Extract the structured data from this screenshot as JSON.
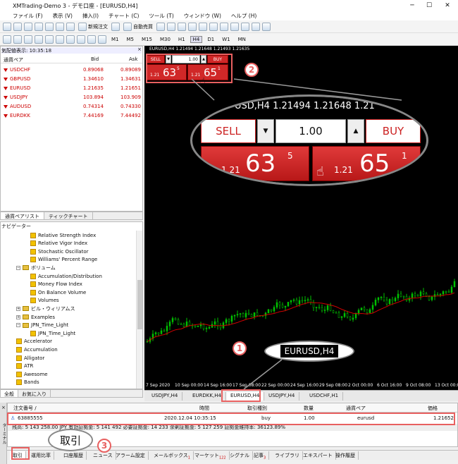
{
  "window": {
    "title": "XMTrading-Demo 3 - デモ口座 - [EURUSD,H4]",
    "minimize": "─",
    "maximize": "☐",
    "close": "✕"
  },
  "menu": [
    "ファイル (F)",
    "表示 (V)",
    "挿入(I)",
    "チャート (C)",
    "ツール (T)",
    "ウィンドウ (W)",
    "ヘルプ (H)"
  ],
  "toolbar": {
    "new_order": "新規注文",
    "auto_trading": "自動売買",
    "timeframes": [
      "M1",
      "M5",
      "M15",
      "M30",
      "H1",
      "H4",
      "D1",
      "W1",
      "MN"
    ],
    "selected_timeframe": "H4"
  },
  "market_watch": {
    "title": "気配値表示: 10:35:18",
    "close": "×",
    "col_symbol": "通貨ペア",
    "col_bid": "Bid",
    "col_ask": "Ask",
    "rows": [
      {
        "symbol": "USDCHF",
        "bid": "0.89068",
        "ask": "0.89089"
      },
      {
        "symbol": "GBPUSD",
        "bid": "1.34610",
        "ask": "1.34631"
      },
      {
        "symbol": "EURUSD",
        "bid": "1.21635",
        "ask": "1.21651"
      },
      {
        "symbol": "USDJPY",
        "bid": "103.894",
        "ask": "103.909"
      },
      {
        "symbol": "AUDUSD",
        "bid": "0.74314",
        "ask": "0.74330"
      },
      {
        "symbol": "EURDKK",
        "bid": "7.44169",
        "ask": "7.44492"
      }
    ],
    "tabs": [
      "通貨ペアリスト",
      "ティックチャート"
    ]
  },
  "navigator": {
    "title": "ナビゲーター",
    "items": [
      {
        "label": "Relative Strength Index",
        "level": 3,
        "icon": "indicator"
      },
      {
        "label": "Relative Vigor Index",
        "level": 3,
        "icon": "indicator"
      },
      {
        "label": "Stochastic Oscillator",
        "level": 3,
        "icon": "indicator"
      },
      {
        "label": "Williams' Percent Range",
        "level": 3,
        "icon": "indicator"
      },
      {
        "label": "ボリューム",
        "level": 2,
        "icon": "folder",
        "exp": "−"
      },
      {
        "label": "Accumulation/Distribution",
        "level": 3,
        "icon": "indicator"
      },
      {
        "label": "Money Flow Index",
        "level": 3,
        "icon": "indicator"
      },
      {
        "label": "On Balance Volume",
        "level": 3,
        "icon": "indicator"
      },
      {
        "label": "Volumes",
        "level": 3,
        "icon": "indicator"
      },
      {
        "label": "ビル・ウィリアムス",
        "level": 2,
        "icon": "folder",
        "exp": "+"
      },
      {
        "label": "Examples",
        "level": 2,
        "icon": "folder",
        "exp": "+"
      },
      {
        "label": "JPN_Time_Light",
        "level": 2,
        "icon": "folder",
        "exp": "−"
      },
      {
        "label": "JPN_Time_Light",
        "level": 3,
        "icon": "indicator"
      },
      {
        "label": "Accelerator",
        "level": 2,
        "icon": "indicator"
      },
      {
        "label": "Accumulation",
        "level": 2,
        "icon": "indicator"
      },
      {
        "label": "Alligator",
        "level": 2,
        "icon": "indicator"
      },
      {
        "label": "ATR",
        "level": 2,
        "icon": "indicator"
      },
      {
        "label": "Awesome",
        "level": 2,
        "icon": "indicator"
      },
      {
        "label": "Bands",
        "level": 2,
        "icon": "indicator"
      }
    ],
    "tabs": [
      "全般",
      "お気に入り"
    ]
  },
  "chart": {
    "title": "EURUSD,H4  1.21494 1.21648 1.21493 1.21635",
    "one_click": {
      "sell": "SELL",
      "buy": "BUY",
      "lot": "1.00",
      "sell_pre": "1.21",
      "sell_big": "63",
      "sell_sup": "5",
      "buy_pre": "1.21",
      "buy_big": "65",
      "buy_sup": "1"
    },
    "zoom_title": "USD,H4   1.21494 1.21648 1.21",
    "time_ticks": [
      "7 Sep 2020",
      "10 Sep 00:00",
      "14 Sep 16:00",
      "17 Sep 08:00",
      "22 Sep 00:00",
      "24 Sep 16:00",
      "29 Sep 08:00",
      "2 Oct 00:00",
      "6 Oct 16:00",
      "9 Oct 08:00",
      "13 Oct 00:00"
    ],
    "tabs": [
      "USDJPY,H4",
      "EURDKK,H4",
      "EURUSD,H4",
      "USDJPY,H4",
      "USDCHF,H1"
    ],
    "active_tab": "EURUSD,H4"
  },
  "callouts": {
    "n1": "1",
    "n2": "2",
    "n3": "3",
    "bubble1": "EURUSD,H4",
    "bubble3": "取引"
  },
  "terminal": {
    "side_label": "ターミナル",
    "close": "×",
    "headers": [
      "注文番号 /",
      "時間",
      "取引種別",
      "数量",
      "通貨ペア",
      "価格"
    ],
    "row": {
      "ticket": "63885555",
      "time": "2020.12.04 10:35:15",
      "type": "buy",
      "volume": "1.00",
      "symbol": "eurusd",
      "price": "1.21652"
    },
    "balance": "残高: 5 143 258.00 JPY 有効証拠金: 5 141 492  必要証拠金: 14 233  余剰証拠金: 5 127 259  証拠金維持率: 36123.89%",
    "tabs": [
      {
        "label": "取引"
      },
      {
        "label": "運用比率"
      },
      {
        "label": "口座履歴"
      },
      {
        "label": "ニュース"
      },
      {
        "label": "アラーム設定"
      },
      {
        "label": "メールボックス",
        "badge": "1"
      },
      {
        "label": "マーケット",
        "badge": "122"
      },
      {
        "label": "シグナル"
      },
      {
        "label": "記事",
        "badge": "3"
      },
      {
        "label": "ライブラリ"
      },
      {
        "label": "エキスパート"
      },
      {
        "label": "操作履歴"
      }
    ]
  },
  "colors": {
    "bull": "#00c000",
    "bear": "#00c000",
    "ma": "#d00000",
    "sell": "#d02828",
    "highlight": "#e86060"
  }
}
